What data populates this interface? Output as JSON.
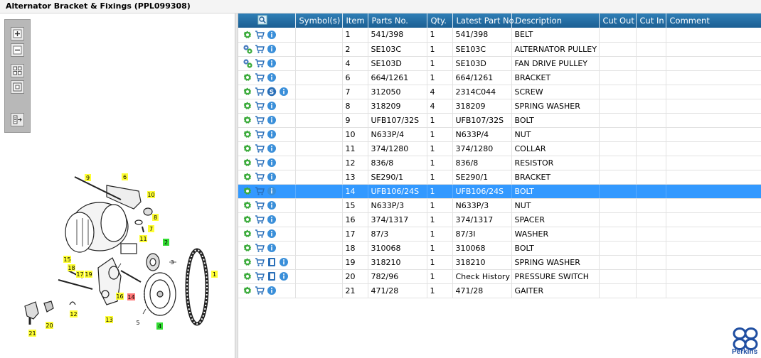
{
  "title": "Alternator Bracket & Fixings (PPL099308)",
  "toolbar": {
    "buttons": [
      "zoom-in",
      "zoom-out",
      "fit-all",
      "fit-window",
      "export"
    ]
  },
  "grid": {
    "columns": [
      "",
      "Symbol(s)",
      "Item",
      "Parts No.",
      "Qty.",
      "Latest Part No.",
      "Description",
      "Cut Out",
      "Cut In",
      "Comment"
    ],
    "rows": [
      {
        "item": "1",
        "part": "541/398",
        "qty": "1",
        "latest": "541/398",
        "desc": "BELT",
        "kit": false,
        "symbol": ""
      },
      {
        "item": "2",
        "part": "SE103C",
        "qty": "1",
        "latest": "SE103C",
        "desc": "ALTERNATOR PULLEY",
        "kit": true,
        "symbol": ""
      },
      {
        "item": "4",
        "part": "SE103D",
        "qty": "1",
        "latest": "SE103D",
        "desc": "FAN DRIVE PULLEY",
        "kit": true,
        "symbol": ""
      },
      {
        "item": "6",
        "part": "664/1261",
        "qty": "1",
        "latest": "664/1261",
        "desc": "BRACKET",
        "kit": false,
        "symbol": ""
      },
      {
        "item": "7",
        "part": "312050",
        "qty": "4",
        "latest": "2314C044",
        "desc": "SCREW",
        "kit": false,
        "symbol": "S"
      },
      {
        "item": "8",
        "part": "318209",
        "qty": "4",
        "latest": "318209",
        "desc": "SPRING WASHER",
        "kit": false,
        "symbol": ""
      },
      {
        "item": "9",
        "part": "UFB107/32S",
        "qty": "1",
        "latest": "UFB107/32S",
        "desc": "BOLT",
        "kit": false,
        "symbol": ""
      },
      {
        "item": "10",
        "part": "N633P/4",
        "qty": "1",
        "latest": "N633P/4",
        "desc": "NUT",
        "kit": false,
        "symbol": ""
      },
      {
        "item": "11",
        "part": "374/1280",
        "qty": "1",
        "latest": "374/1280",
        "desc": "COLLAR",
        "kit": false,
        "symbol": ""
      },
      {
        "item": "12",
        "part": "836/8",
        "qty": "1",
        "latest": "836/8",
        "desc": "RESISTOR",
        "kit": false,
        "symbol": ""
      },
      {
        "item": "13",
        "part": "SE290/1",
        "qty": "1",
        "latest": "SE290/1",
        "desc": "BRACKET",
        "kit": false,
        "symbol": ""
      },
      {
        "item": "14",
        "part": "UFB106/24S",
        "qty": "1",
        "latest": "UFB106/24S",
        "desc": "BOLT",
        "kit": false,
        "symbol": "",
        "selected": true
      },
      {
        "item": "15",
        "part": "N633P/3",
        "qty": "1",
        "latest": "N633P/3",
        "desc": "NUT",
        "kit": false,
        "symbol": ""
      },
      {
        "item": "16",
        "part": "374/1317",
        "qty": "1",
        "latest": "374/1317",
        "desc": "SPACER",
        "kit": false,
        "symbol": ""
      },
      {
        "item": "17",
        "part": "87/3",
        "qty": "1",
        "latest": "87/3I",
        "desc": "WASHER",
        "kit": false,
        "symbol": ""
      },
      {
        "item": "18",
        "part": "310068",
        "qty": "1",
        "latest": "310068",
        "desc": "BOLT",
        "kit": false,
        "symbol": ""
      },
      {
        "item": "19",
        "part": "318210",
        "qty": "1",
        "latest": "318210",
        "desc": "SPRING WASHER",
        "kit": false,
        "symbol": "doc"
      },
      {
        "item": "20",
        "part": "782/96",
        "qty": "1",
        "latest": "Check History",
        "desc": "PRESSURE SWITCH",
        "kit": false,
        "symbol": "doc"
      },
      {
        "item": "21",
        "part": "471/28",
        "qty": "1",
        "latest": "471/28",
        "desc": "GAITER",
        "kit": false,
        "symbol": ""
      }
    ]
  },
  "diagram": {
    "callouts": [
      {
        "label": "9",
        "color": "#ffff33"
      },
      {
        "label": "6",
        "color": "#ffff33"
      },
      {
        "label": "10",
        "color": "#ffff33"
      },
      {
        "label": "8",
        "color": "#ffff33"
      },
      {
        "label": "7",
        "color": "#ffff33"
      },
      {
        "label": "11",
        "color": "#ffff33"
      },
      {
        "label": "2",
        "color": "#33dd33"
      },
      {
        "label": "3",
        "color": "none"
      },
      {
        "label": "15",
        "color": "#ffff33"
      },
      {
        "label": "18",
        "color": "#ffff33"
      },
      {
        "label": "17",
        "color": "#ffff33"
      },
      {
        "label": "19",
        "color": "#ffff33"
      },
      {
        "label": "1",
        "color": "#ffff33"
      },
      {
        "label": "16",
        "color": "#ffff33"
      },
      {
        "label": "14",
        "color": "#ff7777"
      },
      {
        "label": "12",
        "color": "#ffff33"
      },
      {
        "label": "13",
        "color": "#ffff33"
      },
      {
        "label": "5",
        "color": "none"
      },
      {
        "label": "4",
        "color": "#33dd33"
      },
      {
        "label": "20",
        "color": "#ffff33"
      },
      {
        "label": "21",
        "color": "#ffff33"
      }
    ]
  },
  "brand": "Perkins",
  "colors": {
    "header": "#2472a8",
    "selected": "#3399ff",
    "gear": "#3cab3c",
    "info": "#3a8fd9"
  }
}
